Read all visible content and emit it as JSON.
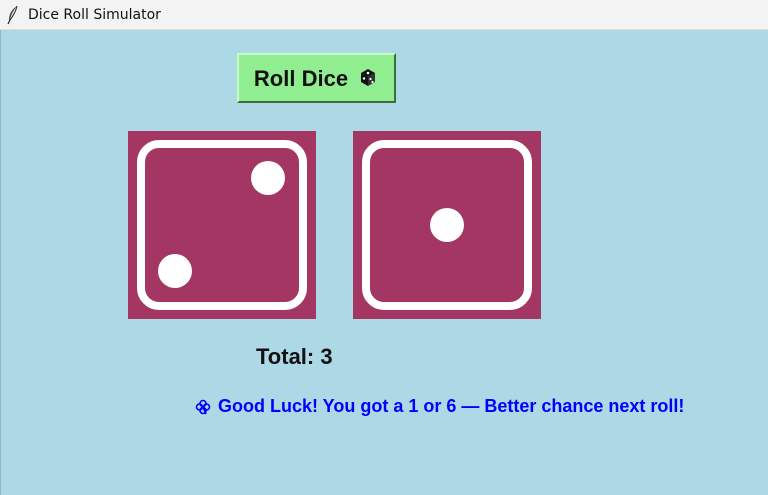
{
  "window": {
    "title": "Dice Roll Simulator",
    "icon": "feather-icon"
  },
  "roll_button": {
    "label": "Roll Dice",
    "icon": "dice-icon",
    "background": "#90ee90"
  },
  "dice": [
    {
      "value": 2,
      "color": "#a33662"
    },
    {
      "value": 1,
      "color": "#a33662"
    }
  ],
  "total": {
    "text": "Total: 3"
  },
  "message": {
    "icon": "clover-icon",
    "text": "Good Luck! You got a 1 or 6 — Better chance next roll!",
    "color": "#0000ff"
  },
  "theme": {
    "background": "#add8e6"
  }
}
